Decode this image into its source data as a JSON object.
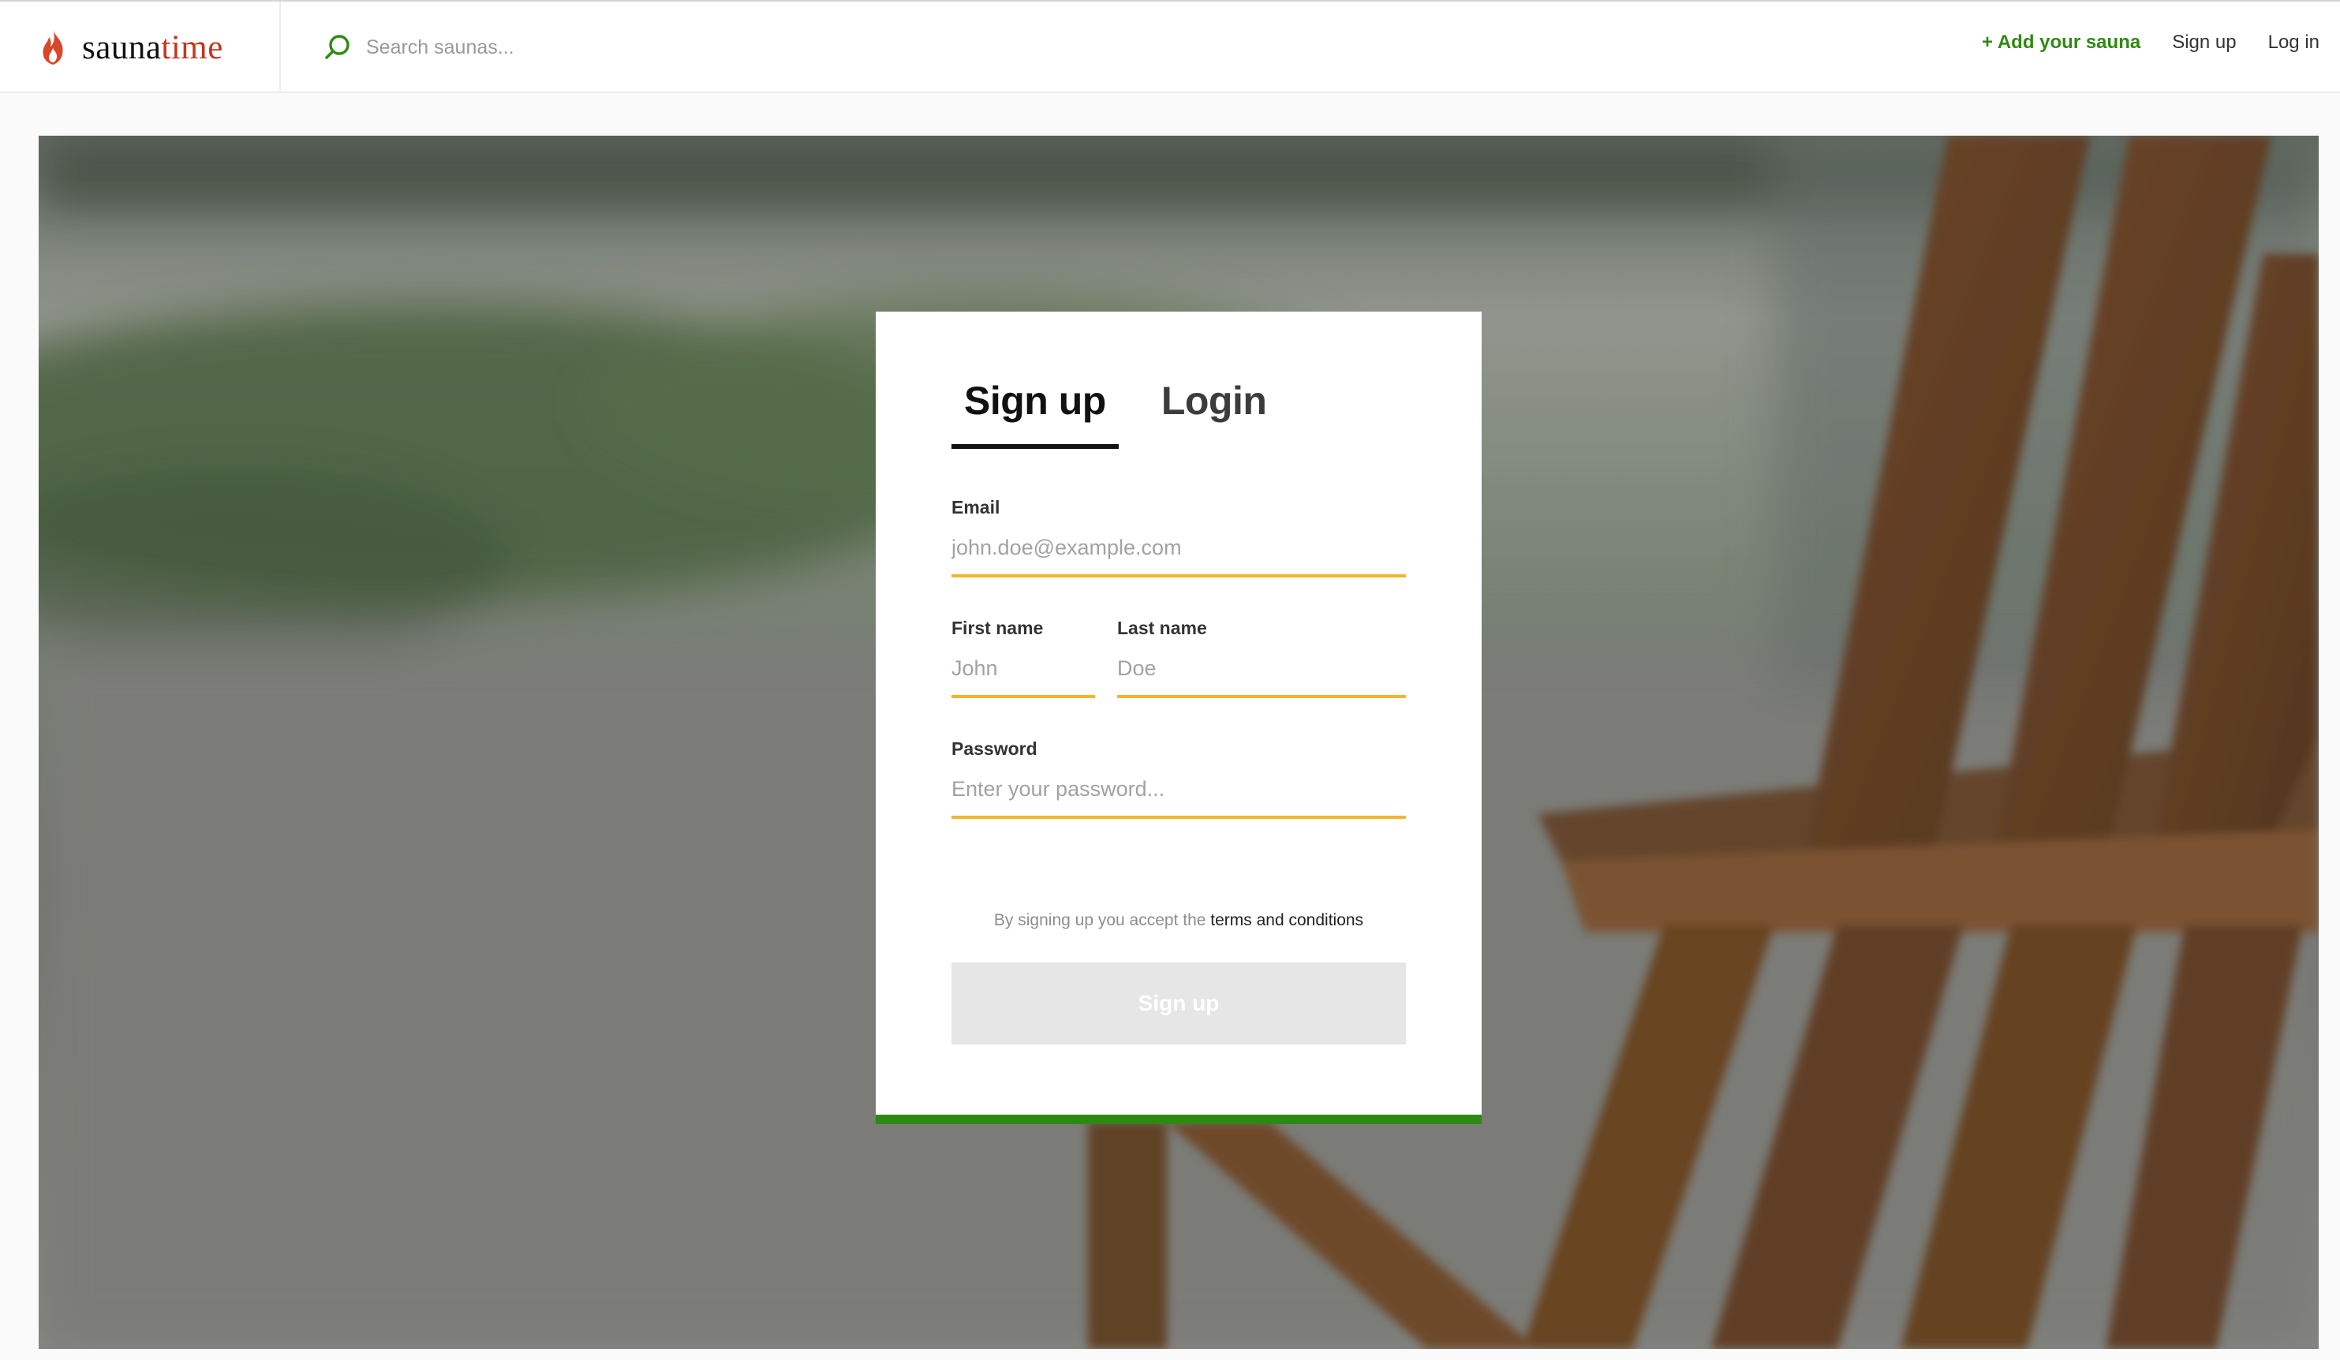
{
  "header": {
    "logo": {
      "word1": "sauna",
      "word2": "time"
    },
    "search": {
      "placeholder": "Search saunas..."
    },
    "nav": {
      "add_sauna": "+ Add your sauna",
      "sign_up": "Sign up",
      "log_in": "Log in"
    }
  },
  "card": {
    "tabs": [
      {
        "label": "Sign up",
        "active": true
      },
      {
        "label": "Login",
        "active": false
      }
    ],
    "fields": {
      "email": {
        "label": "Email",
        "placeholder": "john.doe@example.com",
        "value": ""
      },
      "first_name": {
        "label": "First name",
        "placeholder": "John",
        "value": ""
      },
      "last_name": {
        "label": "Last name",
        "placeholder": "Doe",
        "value": ""
      },
      "password": {
        "label": "Password",
        "placeholder": "Enter your password...",
        "value": ""
      }
    },
    "terms": {
      "prefix": "By signing up you accept the",
      "link": "terms and conditions"
    },
    "submit_label": "Sign up"
  },
  "colors": {
    "brand_red": "#c5361d",
    "accent_green": "#2c8a14",
    "input_underline": "#f5b430",
    "disabled_button": "#e6e6e6"
  },
  "icons": {
    "logo": "flame-icon",
    "search": "search-icon"
  }
}
